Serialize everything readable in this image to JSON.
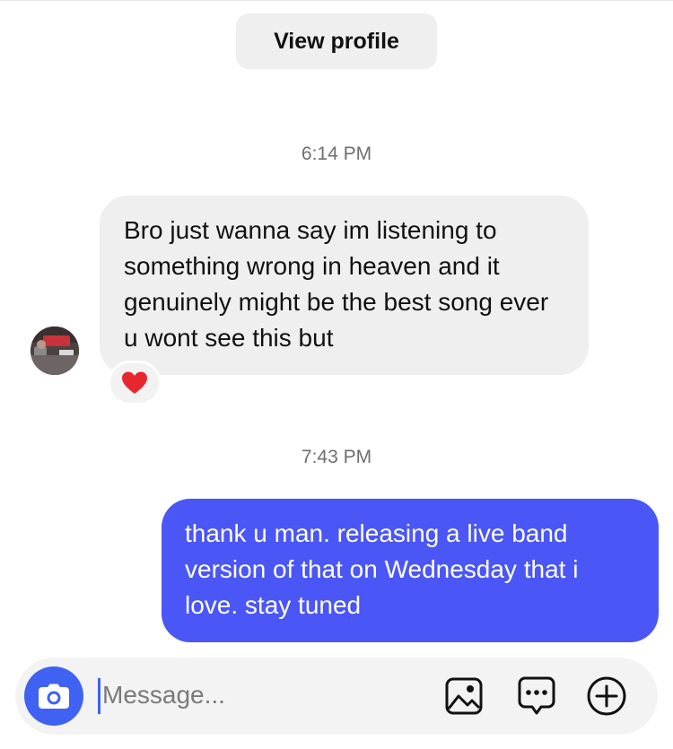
{
  "header": {
    "view_profile_label": "View profile"
  },
  "messages": [
    {
      "timestamp": "6:14 PM"
    },
    {
      "direction": "incoming",
      "text": "Bro just wanna say im listening to something wrong in heaven and it genuinely might be the best song ever u wont see this but",
      "reaction": "heart"
    },
    {
      "timestamp": "7:43 PM"
    },
    {
      "direction": "outgoing",
      "text": "thank u man. releasing a live band version of that on Wednesday that i love. stay tuned"
    }
  ],
  "composer": {
    "placeholder": "Message...",
    "value": "",
    "icons": [
      "camera-icon",
      "gallery-icon",
      "sticker-chat-icon",
      "plus-icon"
    ]
  },
  "colors": {
    "outgoing_bubble": "#4a56f5",
    "incoming_bubble": "#efefef",
    "camera_button": "#3f62f2",
    "reaction_heart": "#e8262e"
  }
}
